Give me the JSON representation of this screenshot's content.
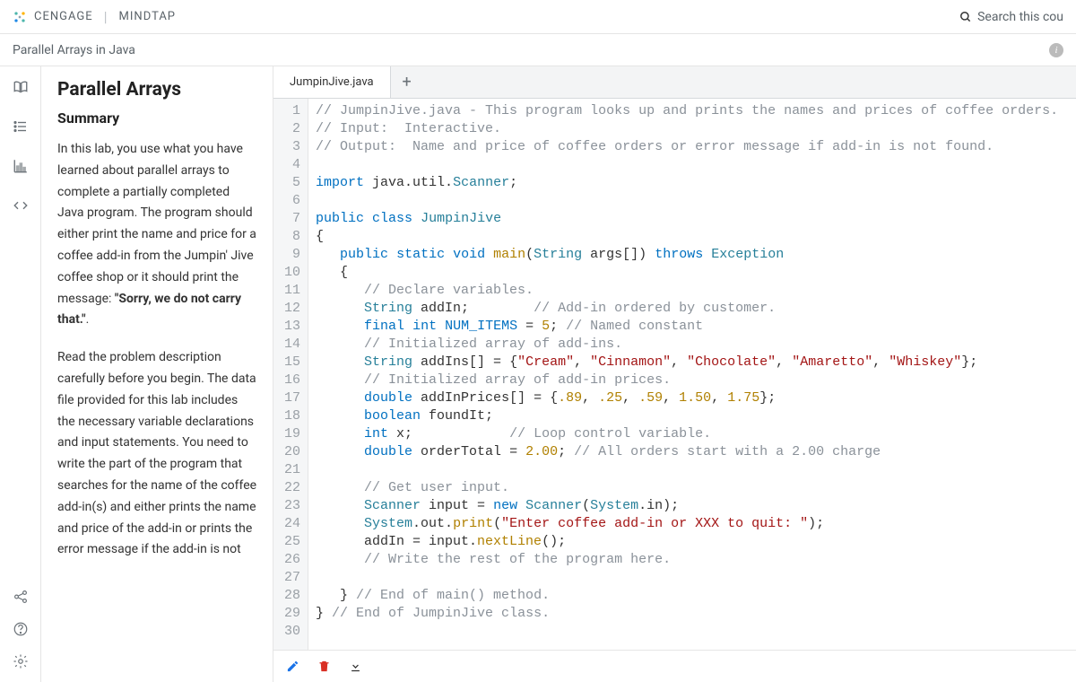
{
  "brand": {
    "company": "CENGAGE",
    "product": "MINDTAP"
  },
  "search": {
    "placeholder": "Search this cou"
  },
  "subheader": {
    "title": "Parallel Arrays in Java"
  },
  "rail_icons": [
    "book-open-icon",
    "list-icon",
    "bar-chart-icon",
    "code-icon"
  ],
  "rail_bottom_icons": [
    "share-icon",
    "help-icon",
    "gear-icon"
  ],
  "lesson": {
    "title": "Parallel Arrays",
    "subtitle": "Summary",
    "para1_a": "In this lab, you use what you have learned about parallel arrays to complete a partially completed Java program. The program should either print the name and price for a coffee add-in from the Jumpin' Jive coffee shop or it should print the message: ",
    "para1_strong": "\"Sorry, we do not carry that.\"",
    "para1_b": ".",
    "para2": "Read the problem description carefully before you begin. The data file provided for this lab includes the necessary variable declarations and input statements. You need to write the part of the program that searches for the name of the coffee add-in(s) and either prints the name and price of the add-in or prints the error message if the add-in is not"
  },
  "editor": {
    "tab": "JumpinJive.java",
    "lines": [
      [
        [
          "comment",
          "// JumpinJive.java - This program looks up and prints the names and prices of coffee orders."
        ]
      ],
      [
        [
          "comment",
          "// Input:  Interactive."
        ]
      ],
      [
        [
          "comment",
          "// Output:  Name and price of coffee orders or error message if add-in is not found."
        ]
      ],
      [],
      [
        [
          "keyword",
          "import"
        ],
        [
          "plain",
          " java.util."
        ],
        [
          "class",
          "Scanner"
        ],
        [
          "plain",
          ";"
        ]
      ],
      [],
      [
        [
          "keyword",
          "public"
        ],
        [
          "plain",
          " "
        ],
        [
          "keyword",
          "class"
        ],
        [
          "plain",
          " "
        ],
        [
          "class",
          "JumpinJive"
        ]
      ],
      [
        [
          "plain",
          "{"
        ]
      ],
      [
        [
          "plain",
          "   "
        ],
        [
          "keyword",
          "public"
        ],
        [
          "plain",
          " "
        ],
        [
          "keyword",
          "static"
        ],
        [
          "plain",
          " "
        ],
        [
          "type",
          "void"
        ],
        [
          "plain",
          " "
        ],
        [
          "method",
          "main"
        ],
        [
          "plain",
          "("
        ],
        [
          "class",
          "String"
        ],
        [
          "plain",
          " args[]) "
        ],
        [
          "keyword",
          "throws"
        ],
        [
          "plain",
          " "
        ],
        [
          "class",
          "Exception"
        ]
      ],
      [
        [
          "plain",
          "   {"
        ]
      ],
      [
        [
          "plain",
          "      "
        ],
        [
          "comment",
          "// Declare variables."
        ]
      ],
      [
        [
          "plain",
          "      "
        ],
        [
          "class",
          "String"
        ],
        [
          "plain",
          " addIn;        "
        ],
        [
          "comment",
          "// Add-in ordered by customer."
        ]
      ],
      [
        [
          "plain",
          "      "
        ],
        [
          "keyword",
          "final"
        ],
        [
          "plain",
          " "
        ],
        [
          "type",
          "int"
        ],
        [
          "plain",
          " "
        ],
        [
          "const",
          "NUM_ITEMS"
        ],
        [
          "plain",
          " = "
        ],
        [
          "number",
          "5"
        ],
        [
          "plain",
          "; "
        ],
        [
          "comment",
          "// Named constant"
        ]
      ],
      [
        [
          "plain",
          "      "
        ],
        [
          "comment",
          "// Initialized array of add-ins."
        ]
      ],
      [
        [
          "plain",
          "      "
        ],
        [
          "class",
          "String"
        ],
        [
          "plain",
          " addIns[] = {"
        ],
        [
          "string",
          "\"Cream\""
        ],
        [
          "plain",
          ", "
        ],
        [
          "string",
          "\"Cinnamon\""
        ],
        [
          "plain",
          ", "
        ],
        [
          "string",
          "\"Chocolate\""
        ],
        [
          "plain",
          ", "
        ],
        [
          "string",
          "\"Amaretto\""
        ],
        [
          "plain",
          ", "
        ],
        [
          "string",
          "\"Whiskey\""
        ],
        [
          "plain",
          "};"
        ]
      ],
      [
        [
          "plain",
          "      "
        ],
        [
          "comment",
          "// Initialized array of add-in prices."
        ]
      ],
      [
        [
          "plain",
          "      "
        ],
        [
          "type",
          "double"
        ],
        [
          "plain",
          " addInPrices[] = {"
        ],
        [
          "number",
          ".89"
        ],
        [
          "plain",
          ", "
        ],
        [
          "number",
          ".25"
        ],
        [
          "plain",
          ", "
        ],
        [
          "number",
          ".59"
        ],
        [
          "plain",
          ", "
        ],
        [
          "number",
          "1.50"
        ],
        [
          "plain",
          ", "
        ],
        [
          "number",
          "1.75"
        ],
        [
          "plain",
          "};"
        ]
      ],
      [
        [
          "plain",
          "      "
        ],
        [
          "type",
          "boolean"
        ],
        [
          "plain",
          " foundIt;"
        ]
      ],
      [
        [
          "plain",
          "      "
        ],
        [
          "type",
          "int"
        ],
        [
          "plain",
          " x;            "
        ],
        [
          "comment",
          "// Loop control variable."
        ]
      ],
      [
        [
          "plain",
          "      "
        ],
        [
          "type",
          "double"
        ],
        [
          "plain",
          " orderTotal = "
        ],
        [
          "number",
          "2.00"
        ],
        [
          "plain",
          "; "
        ],
        [
          "comment",
          "// All orders start with a 2.00 charge"
        ]
      ],
      [],
      [
        [
          "plain",
          "      "
        ],
        [
          "comment",
          "// Get user input."
        ]
      ],
      [
        [
          "plain",
          "      "
        ],
        [
          "class",
          "Scanner"
        ],
        [
          "plain",
          " input = "
        ],
        [
          "keyword",
          "new"
        ],
        [
          "plain",
          " "
        ],
        [
          "class",
          "Scanner"
        ],
        [
          "plain",
          "("
        ],
        [
          "class",
          "System"
        ],
        [
          "plain",
          ".in);"
        ]
      ],
      [
        [
          "plain",
          "      "
        ],
        [
          "class",
          "System"
        ],
        [
          "plain",
          ".out."
        ],
        [
          "method",
          "print"
        ],
        [
          "plain",
          "("
        ],
        [
          "string",
          "\"Enter coffee add-in or XXX to quit: \""
        ],
        [
          "plain",
          ");"
        ]
      ],
      [
        [
          "plain",
          "      addIn = input."
        ],
        [
          "method",
          "nextLine"
        ],
        [
          "plain",
          "();"
        ]
      ],
      [
        [
          "plain",
          "      "
        ],
        [
          "comment",
          "// Write the rest of the program here."
        ]
      ],
      [],
      [
        [
          "plain",
          "   } "
        ],
        [
          "comment",
          "// End of main() method."
        ]
      ],
      [
        [
          "plain",
          "} "
        ],
        [
          "comment",
          "// End of JumpinJive class."
        ]
      ],
      []
    ]
  },
  "toolbar_icons": [
    "pencil-icon",
    "trash-icon",
    "download-icon"
  ]
}
